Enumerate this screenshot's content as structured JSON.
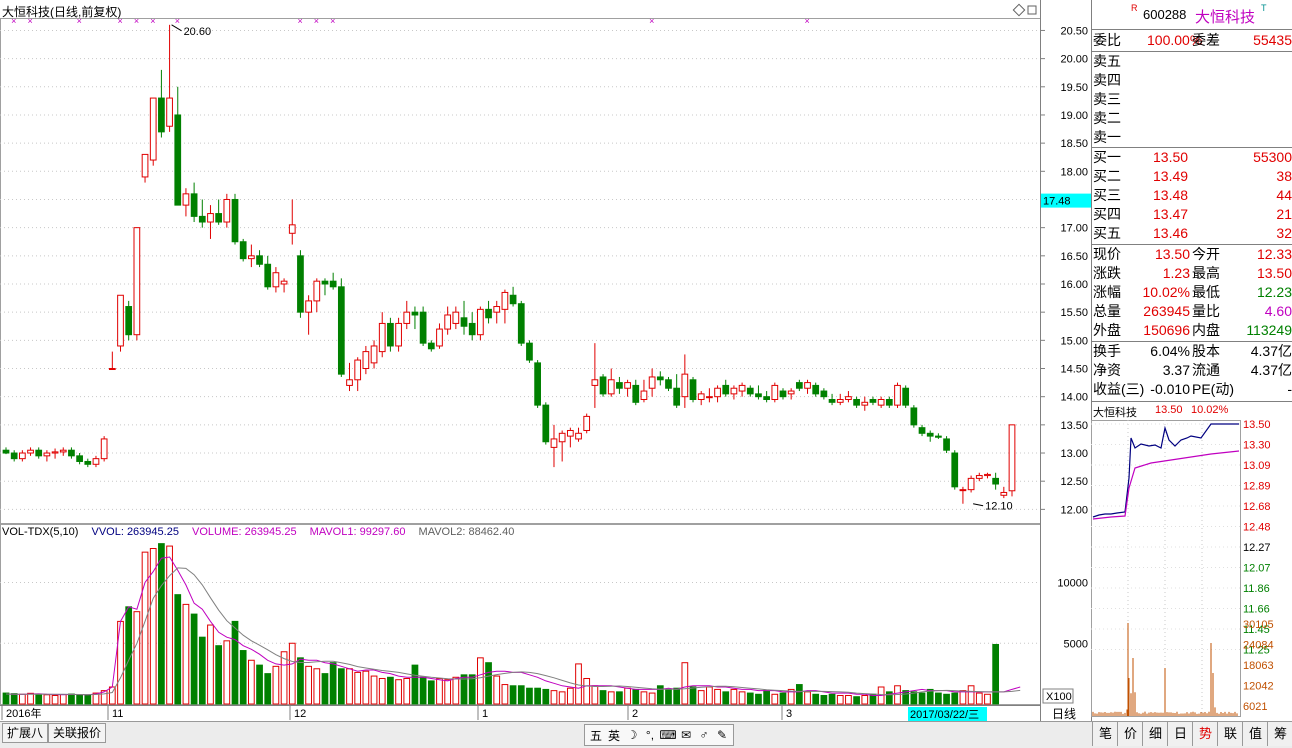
{
  "header": {
    "title": "大恒科技(日线,前复权)"
  },
  "price_axis": {
    "labels": [
      "20.50",
      "20.00",
      "19.50",
      "19.00",
      "18.50",
      "18.00",
      "17.50",
      "17.00",
      "16.50",
      "16.00",
      "15.50",
      "15.00",
      "14.50",
      "14.00",
      "13.50",
      "13.00",
      "12.50",
      "12.00"
    ],
    "current_marker": "17.48"
  },
  "annotations": {
    "high_label": "20.60",
    "low_label": "12.10"
  },
  "volume_axis": {
    "labels": [
      "10000",
      "5000"
    ],
    "unit": "X100"
  },
  "indicator": {
    "name": "VOL-TDX(5,10)",
    "vvol": "VVOL: 263945.25",
    "volume": "VOLUME: 263945.25",
    "mavol1": "MAVOL1: 99297.60",
    "mavol2": "MAVOL2: 88462.40"
  },
  "date_axis": {
    "labels": [
      "2016年",
      "11",
      "12",
      "1",
      "2",
      "3"
    ],
    "cursor_date": "2017/03/22/三",
    "period": "日线"
  },
  "colors": {
    "up": "#e00000",
    "down": "#008000",
    "ma1": "#c000c0",
    "ma2": "#808080"
  },
  "quote": {
    "code": "600288",
    "name": "大恒科技",
    "tag_r": "R",
    "tag_t": "T",
    "weibi_label": "委比",
    "weibi": "100.00%",
    "weicha_label": "委差",
    "weicha": "55435",
    "sells": [
      {
        "label": "卖五"
      },
      {
        "label": "卖四"
      },
      {
        "label": "卖三"
      },
      {
        "label": "卖二"
      },
      {
        "label": "卖一"
      }
    ],
    "buys": [
      {
        "label": "买一",
        "price": "13.50",
        "vol": "55300"
      },
      {
        "label": "买二",
        "price": "13.49",
        "vol": "38"
      },
      {
        "label": "买三",
        "price": "13.48",
        "vol": "44"
      },
      {
        "label": "买四",
        "price": "13.47",
        "vol": "21"
      },
      {
        "label": "买五",
        "price": "13.46",
        "vol": "32"
      }
    ],
    "stats": [
      {
        "l1": "现价",
        "v1": "13.50",
        "l2": "今开",
        "v2": "12.33",
        "c1": "red",
        "c2": "red"
      },
      {
        "l1": "涨跌",
        "v1": "1.23",
        "l2": "最高",
        "v2": "13.50",
        "c1": "red",
        "c2": "red"
      },
      {
        "l1": "涨幅",
        "v1": "10.02%",
        "l2": "最低",
        "v2": "12.23",
        "c1": "red",
        "c2": "green"
      },
      {
        "l1": "总量",
        "v1": "263945",
        "l2": "量比",
        "v2": "4.60",
        "c1": "red",
        "c2": "mag"
      },
      {
        "l1": "外盘",
        "v1": "150696",
        "l2": "内盘",
        "v2": "113249",
        "c1": "red",
        "c2": "green"
      }
    ],
    "stats2": [
      {
        "l1": "换手",
        "v1": "6.04%",
        "l2": "股本",
        "v2": "4.37亿"
      },
      {
        "l1": "净资",
        "v1": "3.37",
        "l2": "流通",
        "v2": "4.37亿"
      },
      {
        "l1": "收益(三)",
        "v1": "-0.010",
        "l2": "PE(动)",
        "v2": "-"
      }
    ]
  },
  "mini_chart": {
    "title": "大恒科技",
    "price": "13.50",
    "pct": "10.02%",
    "labels_up": [
      "13.50",
      "13.30",
      "13.09",
      "12.89",
      "12.68",
      "12.48"
    ],
    "label_mid": "12.27",
    "labels_down": [
      "12.07",
      "11.86",
      "11.66",
      "11.45",
      "11.25"
    ],
    "vol_labels": [
      "30105",
      "24084",
      "18063",
      "12042",
      "6021"
    ]
  },
  "bottom_tabs": [
    "扩展八",
    "关联报价"
  ],
  "right_tabs": [
    "笔",
    "价",
    "细",
    "日",
    "势",
    "联",
    "值",
    "筹"
  ],
  "ime": [
    "五",
    "英",
    "☽",
    "°,",
    "⌨",
    "✉",
    "♂",
    "✎"
  ],
  "chart_data": {
    "type": "candlestick",
    "title": "大恒科技(日线,前复权)",
    "ylim": [
      11.9,
      20.65
    ],
    "x_labels": [
      "2016年",
      "11",
      "12",
      "1",
      "2",
      "3"
    ],
    "candles": [
      [
        13.05,
        13.1,
        12.98,
        13.0
      ],
      [
        13.0,
        13.05,
        12.85,
        12.9
      ],
      [
        12.9,
        13.05,
        12.85,
        13.0
      ],
      [
        13.0,
        13.1,
        12.95,
        13.05
      ],
      [
        13.05,
        13.1,
        12.9,
        12.95
      ],
      [
        12.95,
        13.05,
        12.85,
        13.0
      ],
      [
        13.0,
        13.08,
        12.9,
        13.02
      ],
      [
        13.02,
        13.1,
        12.95,
        13.05
      ],
      [
        13.05,
        13.1,
        12.9,
        12.95
      ],
      [
        12.95,
        13.0,
        12.8,
        12.85
      ],
      [
        12.85,
        12.9,
        12.75,
        12.8
      ],
      [
        12.8,
        12.95,
        12.75,
        12.9
      ],
      [
        12.9,
        13.3,
        12.85,
        13.25
      ],
      [
        14.5,
        14.8,
        14.5,
        14.5
      ],
      [
        14.9,
        15.8,
        14.8,
        15.8
      ],
      [
        15.6,
        15.7,
        15.0,
        15.1
      ],
      [
        15.1,
        17.0,
        15.0,
        17.0
      ],
      [
        17.9,
        18.3,
        17.8,
        18.3
      ],
      [
        18.2,
        19.3,
        18.1,
        19.3
      ],
      [
        19.3,
        19.8,
        18.6,
        18.7
      ],
      [
        18.8,
        20.6,
        18.7,
        19.3
      ],
      [
        19.0,
        19.5,
        17.4,
        17.4
      ],
      [
        17.4,
        17.7,
        17.2,
        17.6
      ],
      [
        17.6,
        17.8,
        17.1,
        17.2
      ],
      [
        17.2,
        17.5,
        17.0,
        17.1
      ],
      [
        17.1,
        17.4,
        16.8,
        17.25
      ],
      [
        17.25,
        17.5,
        17.05,
        17.1
      ],
      [
        17.1,
        17.6,
        17.0,
        17.5
      ],
      [
        17.5,
        17.6,
        16.7,
        16.75
      ],
      [
        16.75,
        16.8,
        16.4,
        16.45
      ],
      [
        16.45,
        16.7,
        16.3,
        16.5
      ],
      [
        16.5,
        16.6,
        16.3,
        16.35
      ],
      [
        16.35,
        16.5,
        15.9,
        15.95
      ],
      [
        15.95,
        16.3,
        15.85,
        16.2
      ],
      [
        16.0,
        16.1,
        15.85,
        16.05
      ],
      [
        16.9,
        17.5,
        16.7,
        17.05
      ],
      [
        16.5,
        16.6,
        15.4,
        15.5
      ],
      [
        15.5,
        15.8,
        15.1,
        15.7
      ],
      [
        15.7,
        16.1,
        15.5,
        16.05
      ],
      [
        16.05,
        16.1,
        15.8,
        16.0
      ],
      [
        16.05,
        16.2,
        15.9,
        15.95
      ],
      [
        15.95,
        16.1,
        14.35,
        14.4
      ],
      [
        14.2,
        14.6,
        14.1,
        14.3
      ],
      [
        14.3,
        14.7,
        14.1,
        14.65
      ],
      [
        14.5,
        14.9,
        14.4,
        14.8
      ],
      [
        14.6,
        15.0,
        14.5,
        14.9
      ],
      [
        14.8,
        15.5,
        14.7,
        15.3
      ],
      [
        15.3,
        15.4,
        14.8,
        14.9
      ],
      [
        14.9,
        15.4,
        14.8,
        15.3
      ],
      [
        15.3,
        15.7,
        15.2,
        15.5
      ],
      [
        15.5,
        15.6,
        15.2,
        15.45
      ],
      [
        15.5,
        15.6,
        14.9,
        14.95
      ],
      [
        14.95,
        15.0,
        14.8,
        14.85
      ],
      [
        14.9,
        15.3,
        14.85,
        15.2
      ],
      [
        15.2,
        15.6,
        15.1,
        15.45
      ],
      [
        15.3,
        15.6,
        15.2,
        15.5
      ],
      [
        15.4,
        15.7,
        15.1,
        15.25
      ],
      [
        15.3,
        15.5,
        15.0,
        15.1
      ],
      [
        15.1,
        15.6,
        15.0,
        15.55
      ],
      [
        15.55,
        15.7,
        15.3,
        15.4
      ],
      [
        15.5,
        15.7,
        15.3,
        15.6
      ],
      [
        15.55,
        15.9,
        15.3,
        15.85
      ],
      [
        15.8,
        15.95,
        15.6,
        15.65
      ],
      [
        15.65,
        15.7,
        14.9,
        14.95
      ],
      [
        14.95,
        15.0,
        14.6,
        14.65
      ],
      [
        14.6,
        14.65,
        13.8,
        13.85
      ],
      [
        13.85,
        13.9,
        13.15,
        13.2
      ],
      [
        13.1,
        13.5,
        12.75,
        13.25
      ],
      [
        13.2,
        13.4,
        12.85,
        13.35
      ],
      [
        13.3,
        13.45,
        13.1,
        13.4
      ],
      [
        13.25,
        13.45,
        13.2,
        13.35
      ],
      [
        13.4,
        13.7,
        13.35,
        13.65
      ],
      [
        14.2,
        14.95,
        13.8,
        14.3
      ],
      [
        14.35,
        14.4,
        14.0,
        14.05
      ],
      [
        14.05,
        14.5,
        14.0,
        14.3
      ],
      [
        14.25,
        14.35,
        14.05,
        14.15
      ],
      [
        14.15,
        14.3,
        14.0,
        14.25
      ],
      [
        14.2,
        14.3,
        13.85,
        13.9
      ],
      [
        13.95,
        14.3,
        13.9,
        14.1
      ],
      [
        14.15,
        14.5,
        14.0,
        14.35
      ],
      [
        14.35,
        14.45,
        14.2,
        14.3
      ],
      [
        14.3,
        14.35,
        14.1,
        14.15
      ],
      [
        14.15,
        14.4,
        13.8,
        13.85
      ],
      [
        14.0,
        14.75,
        13.8,
        14.4
      ],
      [
        14.3,
        14.35,
        13.9,
        13.95
      ],
      [
        13.95,
        14.1,
        13.85,
        14.05
      ],
      [
        14.0,
        14.15,
        13.9,
        14.0
      ],
      [
        14.0,
        14.2,
        13.9,
        14.15
      ],
      [
        14.2,
        14.3,
        14.0,
        14.05
      ],
      [
        14.05,
        14.2,
        13.95,
        14.15
      ],
      [
        14.1,
        14.25,
        14.0,
        14.2
      ],
      [
        14.15,
        14.2,
        14.0,
        14.05
      ],
      [
        14.05,
        14.2,
        13.95,
        14.0
      ],
      [
        14.0,
        14.1,
        13.9,
        13.95
      ],
      [
        13.95,
        14.25,
        13.9,
        14.2
      ],
      [
        14.1,
        14.15,
        13.95,
        14.0
      ],
      [
        14.05,
        14.15,
        13.95,
        14.1
      ],
      [
        14.25,
        14.3,
        14.1,
        14.15
      ],
      [
        14.15,
        14.3,
        14.05,
        14.25
      ],
      [
        14.2,
        14.25,
        14.0,
        14.05
      ],
      [
        14.1,
        14.15,
        13.95,
        14.0
      ],
      [
        13.95,
        14.05,
        13.85,
        13.9
      ],
      [
        13.9,
        14.05,
        13.85,
        13.95
      ],
      [
        13.95,
        14.1,
        13.9,
        14.0
      ],
      [
        13.95,
        14.0,
        13.8,
        13.85
      ],
      [
        13.85,
        14.0,
        13.75,
        13.9
      ],
      [
        13.95,
        14.0,
        13.85,
        13.9
      ],
      [
        13.85,
        14.0,
        13.8,
        13.95
      ],
      [
        13.95,
        14.0,
        13.8,
        13.85
      ],
      [
        13.85,
        14.25,
        13.8,
        14.2
      ],
      [
        14.15,
        14.2,
        13.8,
        13.85
      ],
      [
        13.8,
        13.85,
        13.45,
        13.5
      ],
      [
        13.45,
        13.5,
        13.3,
        13.35
      ],
      [
        13.35,
        13.4,
        13.2,
        13.3
      ],
      [
        13.3,
        13.35,
        13.25,
        13.28
      ],
      [
        13.25,
        13.3,
        13.0,
        13.05
      ],
      [
        13.0,
        13.05,
        12.35,
        12.4
      ],
      [
        12.35,
        12.4,
        12.1,
        12.35
      ],
      [
        12.35,
        12.6,
        12.3,
        12.55
      ],
      [
        12.55,
        12.65,
        12.5,
        12.6
      ],
      [
        12.6,
        12.65,
        12.55,
        12.62
      ],
      [
        12.55,
        12.65,
        12.35,
        12.45
      ],
      [
        12.25,
        12.4,
        12.2,
        12.3
      ],
      [
        12.33,
        13.5,
        12.23,
        13.5
      ]
    ],
    "volumes": [
      900,
      850,
      800,
      880,
      820,
      760,
      700,
      780,
      820,
      740,
      700,
      900,
      1100,
      1400,
      6800,
      8000,
      7600,
      12500,
      12800,
      13200,
      13000,
      9000,
      8200,
      7400,
      5500,
      6500,
      4800,
      5200,
      6800,
      4400,
      3600,
      3200,
      2500,
      3100,
      4300,
      5000,
      3800,
      3100,
      2900,
      2500,
      3400,
      2900,
      2900,
      2600,
      2700,
      2300,
      2100,
      2200,
      2000,
      2100,
      3200,
      2200,
      1900,
      2100,
      2000,
      2200,
      2400,
      2400,
      3800,
      3400,
      2300,
      1600,
      1500,
      1500,
      1300,
      1300,
      1200,
      1100,
      1000,
      1300,
      3300,
      2100,
      1500,
      1100,
      1000,
      1000,
      1300,
      1200,
      1000,
      900,
      1500,
      1200,
      1300,
      3400,
      1400,
      1100,
      1400,
      1200,
      1000,
      1200,
      1000,
      900,
      800,
      1100,
      800,
      900,
      1200,
      1600,
      1000,
      800,
      700,
      800,
      700,
      700,
      600,
      700,
      800,
      1400,
      1000,
      1500,
      1100,
      1000,
      900,
      1200,
      900,
      800,
      900,
      1100,
      1500,
      900,
      800,
      4900
    ],
    "mavol1": [
      820,
      800,
      790,
      820,
      840,
      800,
      780,
      760,
      790,
      770,
      760,
      820,
      1000,
      1400,
      6800,
      8000,
      7800,
      10000,
      10900,
      12000,
      12100,
      11000,
      9800,
      8300,
      7800,
      6800,
      5900,
      5500,
      5300,
      4800,
      4500,
      4100,
      3600,
      3300,
      3200,
      3300,
      3700,
      3600,
      3600,
      3400,
      3300,
      3100,
      2900,
      2700,
      2800,
      2800,
      2600,
      2500,
      2300,
      2200,
      2200,
      2200,
      2100,
      2000,
      1900,
      2100,
      2200,
      2200,
      2400,
      2600,
      2700,
      2700,
      2600,
      2600,
      2400,
      2200,
      1900,
      1700,
      1500,
      1400,
      1300,
      1500,
      1500,
      1500,
      1500,
      1400,
      1300,
      1200,
      1200,
      1200,
      1200,
      1300,
      1200,
      1400,
      1500,
      1500,
      1500,
      1400,
      1400,
      1300,
      1200,
      1200,
      1100,
      1100,
      1100,
      1000,
      1000,
      1000,
      1100,
      1100,
      1000,
      900,
      900,
      900,
      800,
      800,
      700,
      700,
      800,
      900,
      1000,
      1100,
      1200,
      1100,
      1100,
      1100,
      1000,
      1000,
      1000,
      1000,
      1000,
      1000,
      1000,
      1200,
      1400
    ]
  }
}
